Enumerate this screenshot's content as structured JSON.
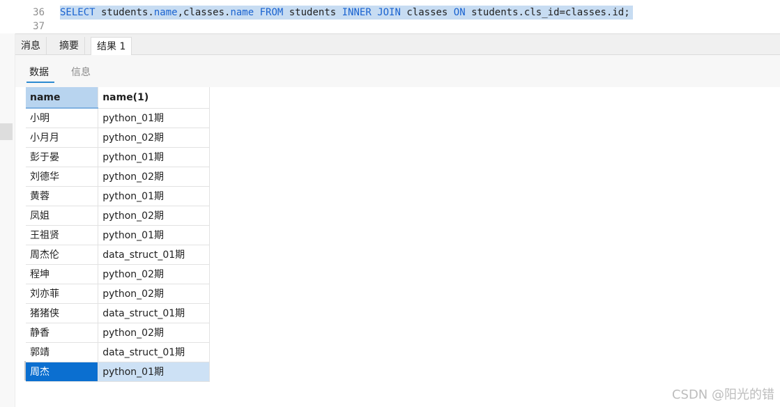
{
  "editor": {
    "lines": [
      {
        "num": "36",
        "tokens": [
          {
            "t": "SELECT",
            "k": true
          },
          {
            "t": " students.",
            "k": false
          },
          {
            "t": "name",
            "k": true
          },
          {
            "t": ",classes.",
            "k": false
          },
          {
            "t": "name",
            "k": true
          },
          {
            "t": " ",
            "k": false
          },
          {
            "t": "FROM",
            "k": true
          },
          {
            "t": " students ",
            "k": false
          },
          {
            "t": "INNER JOIN",
            "k": true
          },
          {
            "t": " classes ",
            "k": false
          },
          {
            "t": "ON",
            "k": true
          },
          {
            "t": " students.cls_id=classes.id;",
            "k": false
          }
        ]
      },
      {
        "num": "37",
        "tokens": []
      }
    ]
  },
  "tabs": [
    {
      "label": "消息",
      "active": false
    },
    {
      "label": "摘要",
      "active": false
    },
    {
      "label": "结果 1",
      "active": true
    }
  ],
  "subtabs": [
    {
      "label": "数据",
      "active": true
    },
    {
      "label": "信息",
      "active": false
    }
  ],
  "grid": {
    "columns": [
      "name",
      "name(1)"
    ],
    "rows": [
      [
        "小明",
        "python_01期"
      ],
      [
        "小月月",
        "python_02期"
      ],
      [
        "彭于晏",
        "python_01期"
      ],
      [
        "刘德华",
        "python_02期"
      ],
      [
        "黄蓉",
        "python_01期"
      ],
      [
        "凤姐",
        "python_02期"
      ],
      [
        "王祖贤",
        "python_01期"
      ],
      [
        "周杰伦",
        "data_struct_01期"
      ],
      [
        "程坤",
        "python_02期"
      ],
      [
        "刘亦菲",
        "python_02期"
      ],
      [
        "猪猪侠",
        "data_struct_01期"
      ],
      [
        "静香",
        "python_02期"
      ],
      [
        "郭靖",
        "data_struct_01期"
      ],
      [
        "周杰",
        "python_01期"
      ]
    ],
    "selected_row": 13
  },
  "watermark": "CSDN @阳光的错",
  "colors": {
    "keyword": "#1a63d0",
    "highlight": "#c7dcf2",
    "selection": "#0b6fd0"
  }
}
